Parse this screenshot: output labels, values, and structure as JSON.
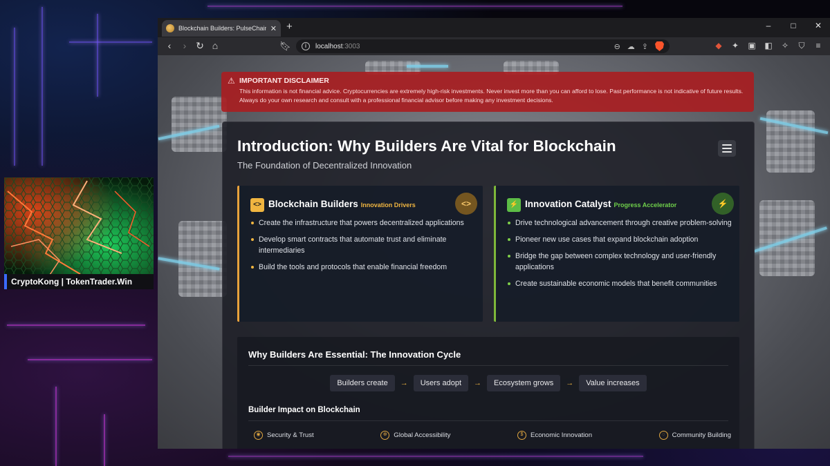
{
  "webcam": {
    "label": "CryptoKong | TokenTrader.Win"
  },
  "browser": {
    "tab_title": "Blockchain Builders: PulseChain",
    "new_tab_icon": "+",
    "window_controls": [
      "–",
      "□",
      "✕"
    ],
    "url_host": "localhost",
    "url_port": ":3003"
  },
  "disclaimer": {
    "title": "IMPORTANT DISCLAIMER",
    "text": "This information is not financial advice. Cryptocurrencies are extremely high-risk investments. Never invest more than you can afford to lose. Past performance is not indicative of future results. Always do your own research and consult with a professional financial advisor before making any investment decisions."
  },
  "card": {
    "title": "Introduction: Why Builders Are Vital for Blockchain",
    "subtitle": "The Foundation of Decentralized Innovation"
  },
  "features": [
    {
      "icon_glyph": "<>",
      "title": "Blockchain Builders",
      "tag": "Innovation Drivers",
      "badge_glyph": "<>",
      "items": [
        "Create the infrastructure that powers decentralized applications",
        "Develop smart contracts that automate trust and eliminate intermediaries",
        "Build the tools and protocols that enable financial freedom"
      ]
    },
    {
      "icon_glyph": "⚡",
      "title": "Innovation Catalyst",
      "tag": "Progress Accelerator",
      "badge_glyph": "⚡",
      "items": [
        "Drive technological advancement through creative problem-solving",
        "Pioneer new use cases that expand blockchain adoption",
        "Bridge the gap between complex technology and user-friendly applications",
        "Create sustainable economic models that benefit communities"
      ]
    }
  ],
  "cycle": {
    "title": "Why Builders Are Essential: The Innovation Cycle",
    "steps": [
      "Builders create",
      "Users adopt",
      "Ecosystem grows",
      "Value increases"
    ],
    "arrow": "→",
    "impact_title": "Builder Impact on Blockchain",
    "impacts": [
      "Security & Trust",
      "Global Accessibility",
      "Economic Innovation",
      "Community Building"
    ]
  },
  "colors": {
    "builders_accent": "#f0b540",
    "catalyst_accent": "#6fd04a",
    "disclaimer_bg": "#a81e22"
  }
}
